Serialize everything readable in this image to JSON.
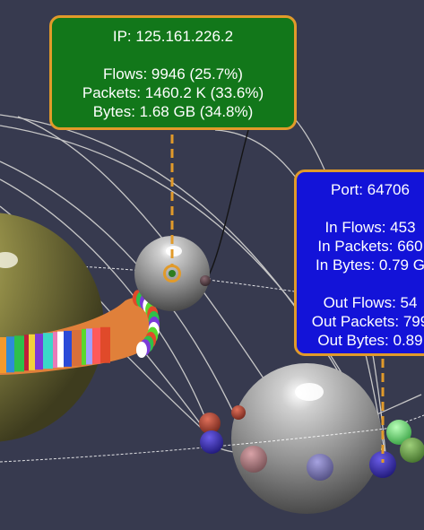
{
  "ip_tooltip": {
    "ip": "IP: 125.161.226.2",
    "flows": "Flows: 9946 (25.7%)",
    "packets": "Packets: 1460.2 K (33.6%)",
    "bytes": "Bytes: 1.68 GB (34.8%)"
  },
  "port_tooltip": {
    "port": "Port: 64706",
    "in_flows": "In Flows: 453",
    "in_packets": "In Packets: 660",
    "in_bytes": "In Bytes: 0.79 G",
    "out_flows": "Out Flows: 54",
    "out_packets": "Out Packets: 799",
    "out_bytes": "Out Bytes: 0.89"
  },
  "colors": {
    "background": "#373a4f",
    "ip_tooltip_bg": "#12771a",
    "port_tooltip_bg": "#1313d8",
    "tooltip_border": "#e19a2a",
    "leader_line": "#e19a2a",
    "planet": "#8f8a46",
    "host_sphere": "#9a9a9a"
  }
}
